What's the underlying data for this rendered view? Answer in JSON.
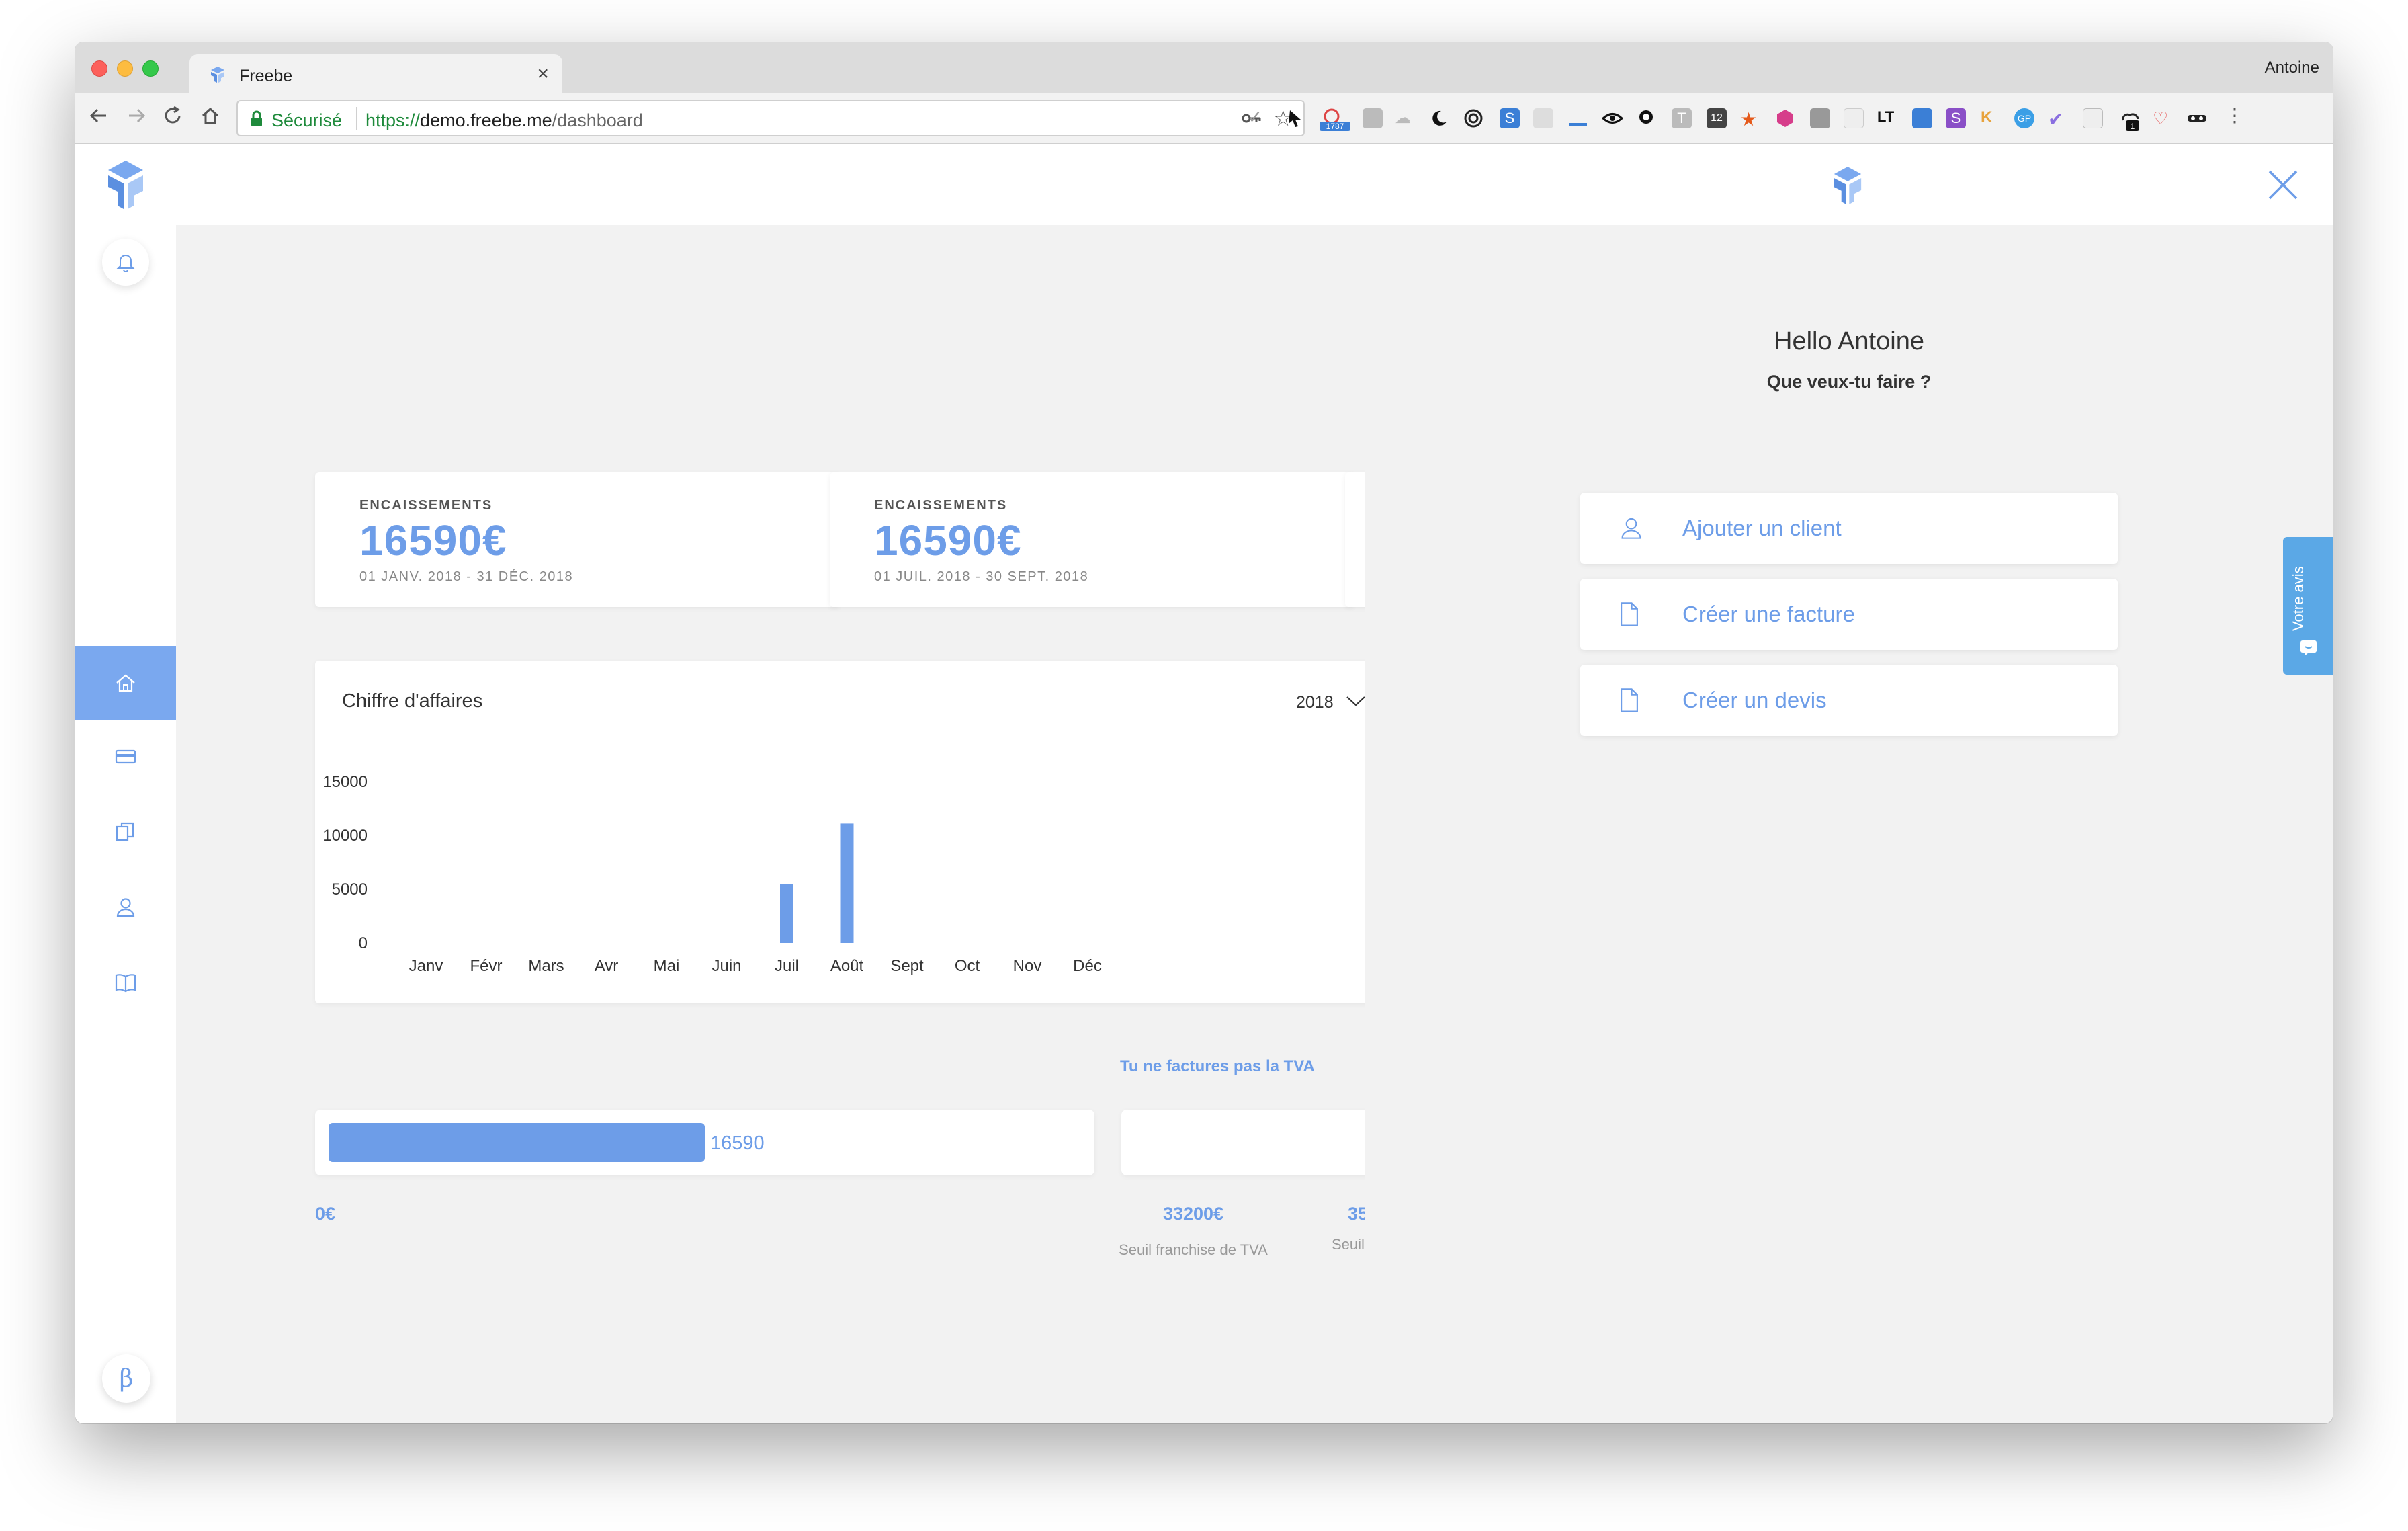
{
  "browser": {
    "tab_title": "Freebe",
    "tab_close": "×",
    "profile_name": "Antoine",
    "secure_label": "Sécurisé",
    "url_scheme": "https://",
    "url_host": "demo.freebe.me",
    "url_path": "/dashboard",
    "ext_badge_count": "1787",
    "ext_badge_count_2": "1",
    "ext_badge_calendar": "12",
    "ext_lt": "LT",
    "ext_gp": "GP",
    "ext_t": "T",
    "ext_s": "S",
    "ext_k": "K",
    "ext_s2": "S"
  },
  "sidebar": {
    "beta_label": "β",
    "items": [
      {
        "name": "home",
        "active": true
      },
      {
        "name": "card",
        "active": false
      },
      {
        "name": "documents",
        "active": false
      },
      {
        "name": "clients",
        "active": false
      },
      {
        "name": "book",
        "active": false
      }
    ]
  },
  "stats": [
    {
      "label": "ENCAISSEMENTS",
      "value": "16590€",
      "date_range": "01 JANV. 2018 - 31 DÉC. 2018"
    },
    {
      "label": "ENCAISSEMENTS",
      "value": "16590€",
      "date_range": "01 JUIL. 2018 - 30 SEPT. 2018"
    }
  ],
  "chart": {
    "title": "Chiffre d'affaires",
    "year": "2018",
    "accent": "#6d9de8"
  },
  "chart_data": {
    "type": "bar",
    "title": "Chiffre d'affaires",
    "categories": [
      "Janv",
      "Févr",
      "Mars",
      "Avr",
      "Mai",
      "Juin",
      "Juil",
      "Août",
      "Sept",
      "Oct",
      "Nov",
      "Déc"
    ],
    "values": [
      0,
      0,
      0,
      0,
      0,
      0,
      5500,
      11100,
      0,
      0,
      0,
      0
    ],
    "ytick_labels": [
      "0",
      "5000",
      "10000",
      "15000"
    ],
    "yticks": [
      0,
      5000,
      10000,
      15000
    ],
    "ylim": [
      0,
      15000
    ],
    "grid": false
  },
  "tva": {
    "link": "Tu ne factures pas la TVA",
    "progress_value": "16590",
    "progress_fraction": 0.4997,
    "scale_min": "0€",
    "scale_mid": "33200€",
    "scale_mid_caption": "Seuil franchise de TVA",
    "scale_right": "35",
    "scale_right_caption": "Seuil"
  },
  "panel": {
    "hello": "Hello Antoine",
    "question": "Que veux-tu faire ?",
    "actions": [
      {
        "label": "Ajouter un client",
        "icon": "user-icon"
      },
      {
        "label": "Créer une facture",
        "icon": "document-icon"
      },
      {
        "label": "Créer un devis",
        "icon": "document-icon"
      }
    ]
  },
  "feedback": {
    "label": "Votre avis"
  },
  "colors": {
    "accent": "#6d9de8",
    "sidebar_active": "#7aa8ef",
    "background": "#f2f2f2",
    "feedback_tab": "#5ba8e6"
  }
}
